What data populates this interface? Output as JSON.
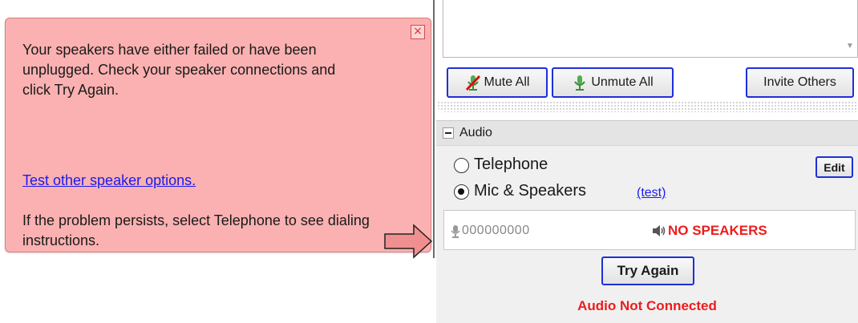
{
  "callout": {
    "close_glyph": "×",
    "message": "Your speakers have either failed or have been unplugged. Check your speaker connections and click Try Again.",
    "link": "Test other speaker options.",
    "persist": "If the problem persists, select Telephone to see dialing instructions."
  },
  "toolbar": {
    "mute_all": "Mute All",
    "unmute_all": "Unmute All",
    "invite_others": "Invite Others"
  },
  "audio": {
    "title": "Audio",
    "telephone_label": "Telephone",
    "mic_label": "Mic & Speakers",
    "test_link": "(test)",
    "edit_label": "Edit",
    "selected": "mic",
    "mic_level": "000000000",
    "speaker_status": "NO SPEAKERS",
    "try_again": "Try Again",
    "footer": "Audio Not Connected"
  },
  "colors": {
    "callout_bg": "#fbb1b1",
    "alert_red": "#ee1c1c",
    "button_border": "#1e2fd9",
    "link_blue": "#1a1aee"
  },
  "icons": {
    "mute": "mic-muted-icon",
    "unmute": "mic-icon",
    "microphone": "mic-icon",
    "speaker": "speaker-icon",
    "arrow": "arrow-right-icon",
    "close": "close-icon"
  }
}
